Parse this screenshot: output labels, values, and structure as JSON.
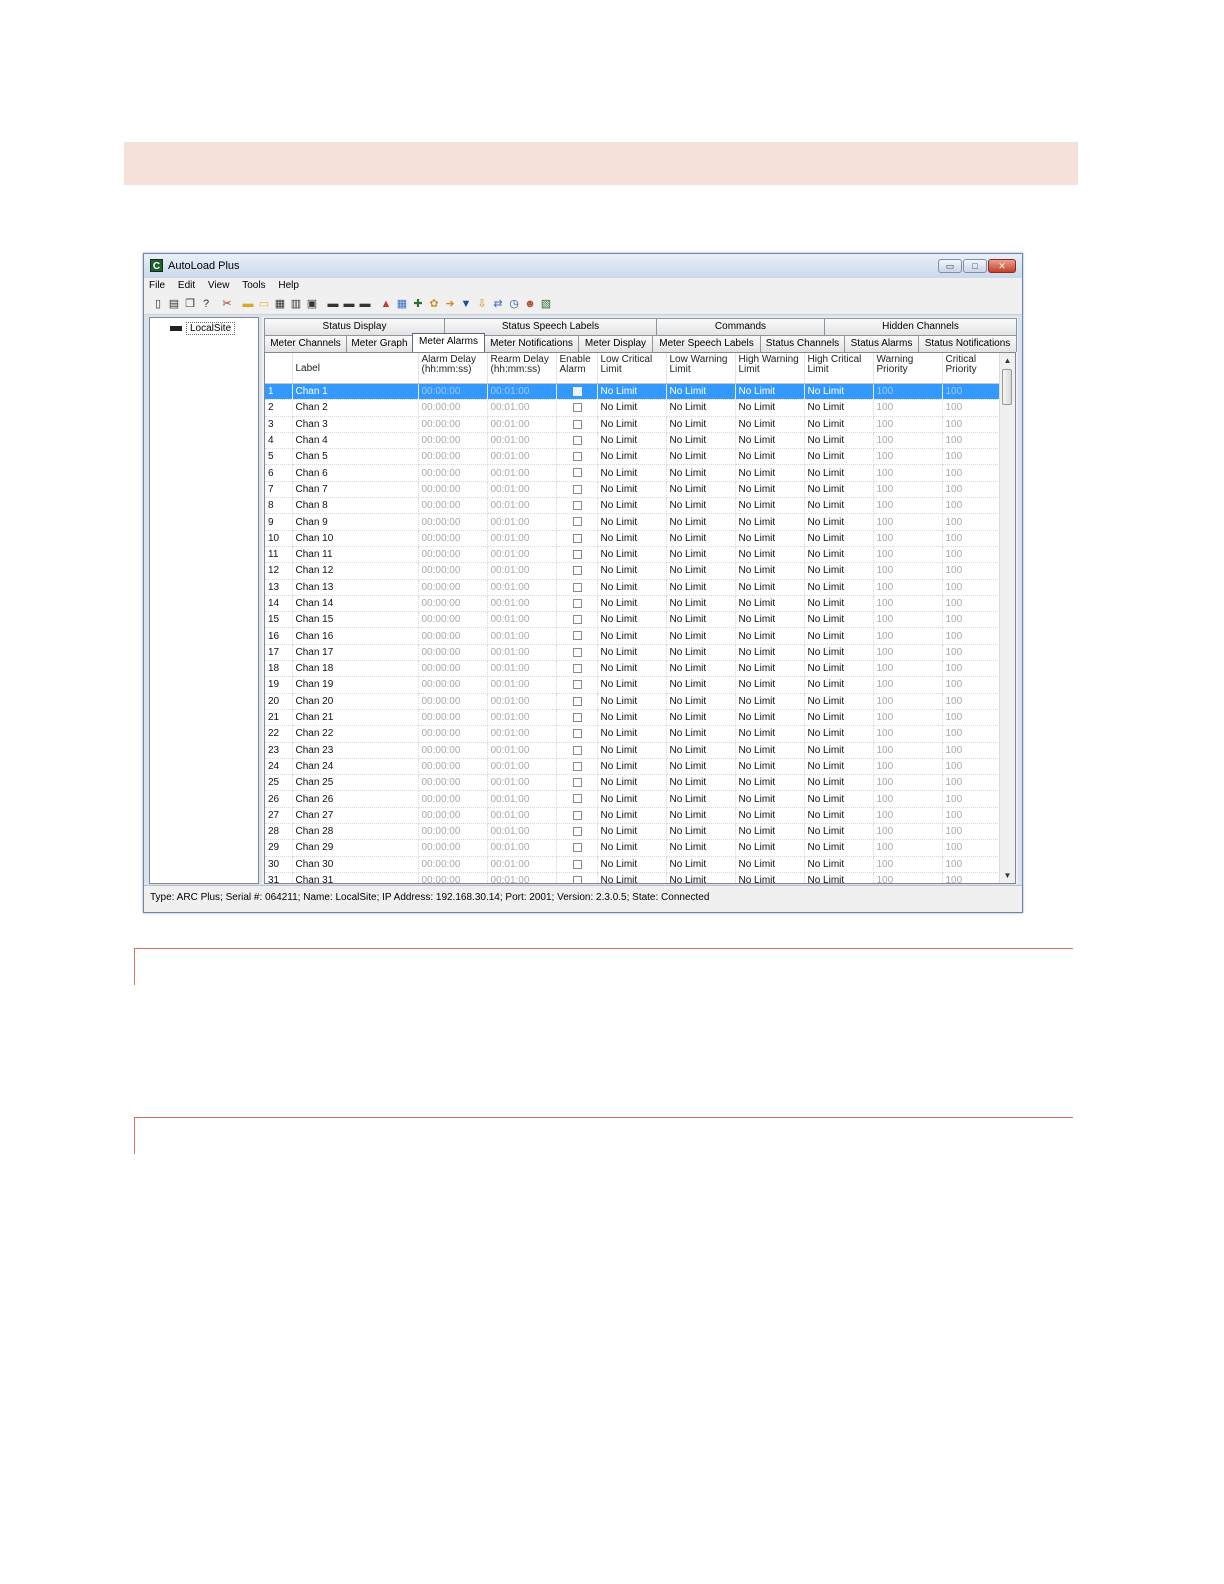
{
  "window": {
    "title": "AutoLoad Plus",
    "buttons": {
      "minimize": "▭",
      "maximize": "□",
      "close": "✕"
    }
  },
  "menu": [
    "File",
    "Edit",
    "View",
    "Tools",
    "Help"
  ],
  "toolbar": {
    "icons": [
      "new-icon",
      "open-icon",
      "copy-icon",
      "help-icon",
      "delete-icon",
      "folder-icon",
      "folder-open-icon",
      "edit-icon",
      "settings-icon",
      "clipboard-icon",
      "device-icon",
      "device-icon",
      "device-icon",
      "alarm-icon",
      "grid-icon",
      "network-icon",
      "config-icon",
      "arrow-icon",
      "filter-icon",
      "download-icon",
      "link-icon",
      "clock-icon",
      "users-icon",
      "chart-icon"
    ]
  },
  "tree": {
    "root": "LocalSite"
  },
  "tabs_row1": [
    "Status Display",
    "Status Speech Labels",
    "Commands",
    "Hidden Channels"
  ],
  "tabs_row2": [
    "Meter Channels",
    "Meter Graph",
    "Meter Alarms",
    "Meter Notifications",
    "Meter Display",
    "Meter Speech Labels",
    "Status Channels",
    "Status Alarms",
    "Status Notifications"
  ],
  "active_tab": "Meter Alarms",
  "grid": {
    "columns": [
      "",
      "Label",
      "Alarm Delay (hh:mm:ss)",
      "Rearm Delay (hh:mm:ss)",
      "Enable Alarm",
      "Low Critical Limit",
      "Low Warning Limit",
      "High Warning Limit",
      "High Critical Limit",
      "Warning Priority",
      "Critical Priority"
    ],
    "selected_row": 1,
    "alarm_delay": "00:00:00",
    "rearm_delay": "00:01:00",
    "limit_value": "No Limit",
    "priority_value": "100",
    "label_prefix": "Chan ",
    "row_count": 31
  },
  "status": "Type: ARC Plus; Serial #: 064211; Name: LocalSite; IP Address: 192.168.30.14; Port: 2001; Version: 2.3.0.5; State: Connected"
}
